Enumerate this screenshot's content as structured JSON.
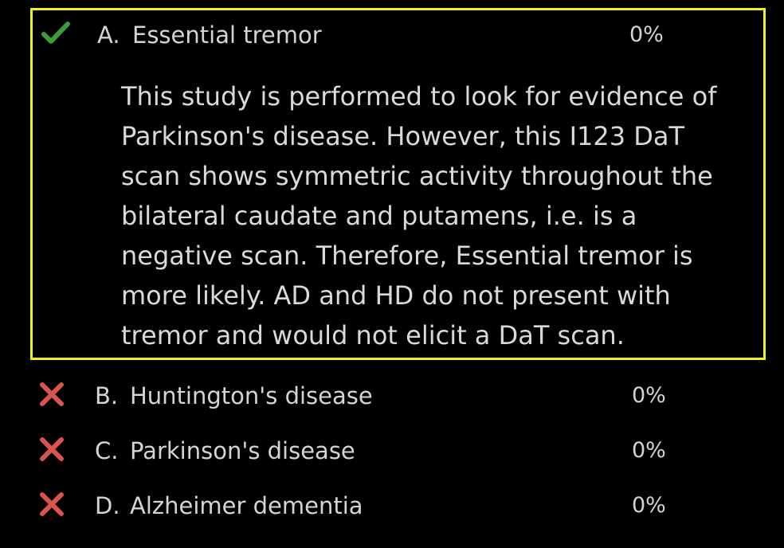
{
  "options": [
    {
      "letter": "A.",
      "text": "Essential tremor",
      "percent": "0%",
      "status_icon": "check-icon",
      "status_color": "#3f9a3f",
      "selected": true,
      "explanation": "This study is performed to look for evidence of Parkinson's disease. However, this I123 DaT scan shows symmetric activity throughout the bilateral caudate and putamens, i.e. is a negative scan. Therefore, Essential tremor is more likely. AD and HD do not present with tremor and would not elicit a DaT scan."
    },
    {
      "letter": "B.",
      "text": "Huntington's disease",
      "percent": "0%",
      "status_icon": "cross-icon",
      "status_color": "#d9534f"
    },
    {
      "letter": "C.",
      "text": "Parkinson's disease",
      "percent": "0%",
      "status_icon": "cross-icon",
      "status_color": "#d9534f"
    },
    {
      "letter": "D.",
      "text": "Alzheimer dementia",
      "percent": "0%",
      "status_icon": "cross-icon",
      "status_color": "#d9534f"
    }
  ],
  "highlight_color": "#f4f01c"
}
